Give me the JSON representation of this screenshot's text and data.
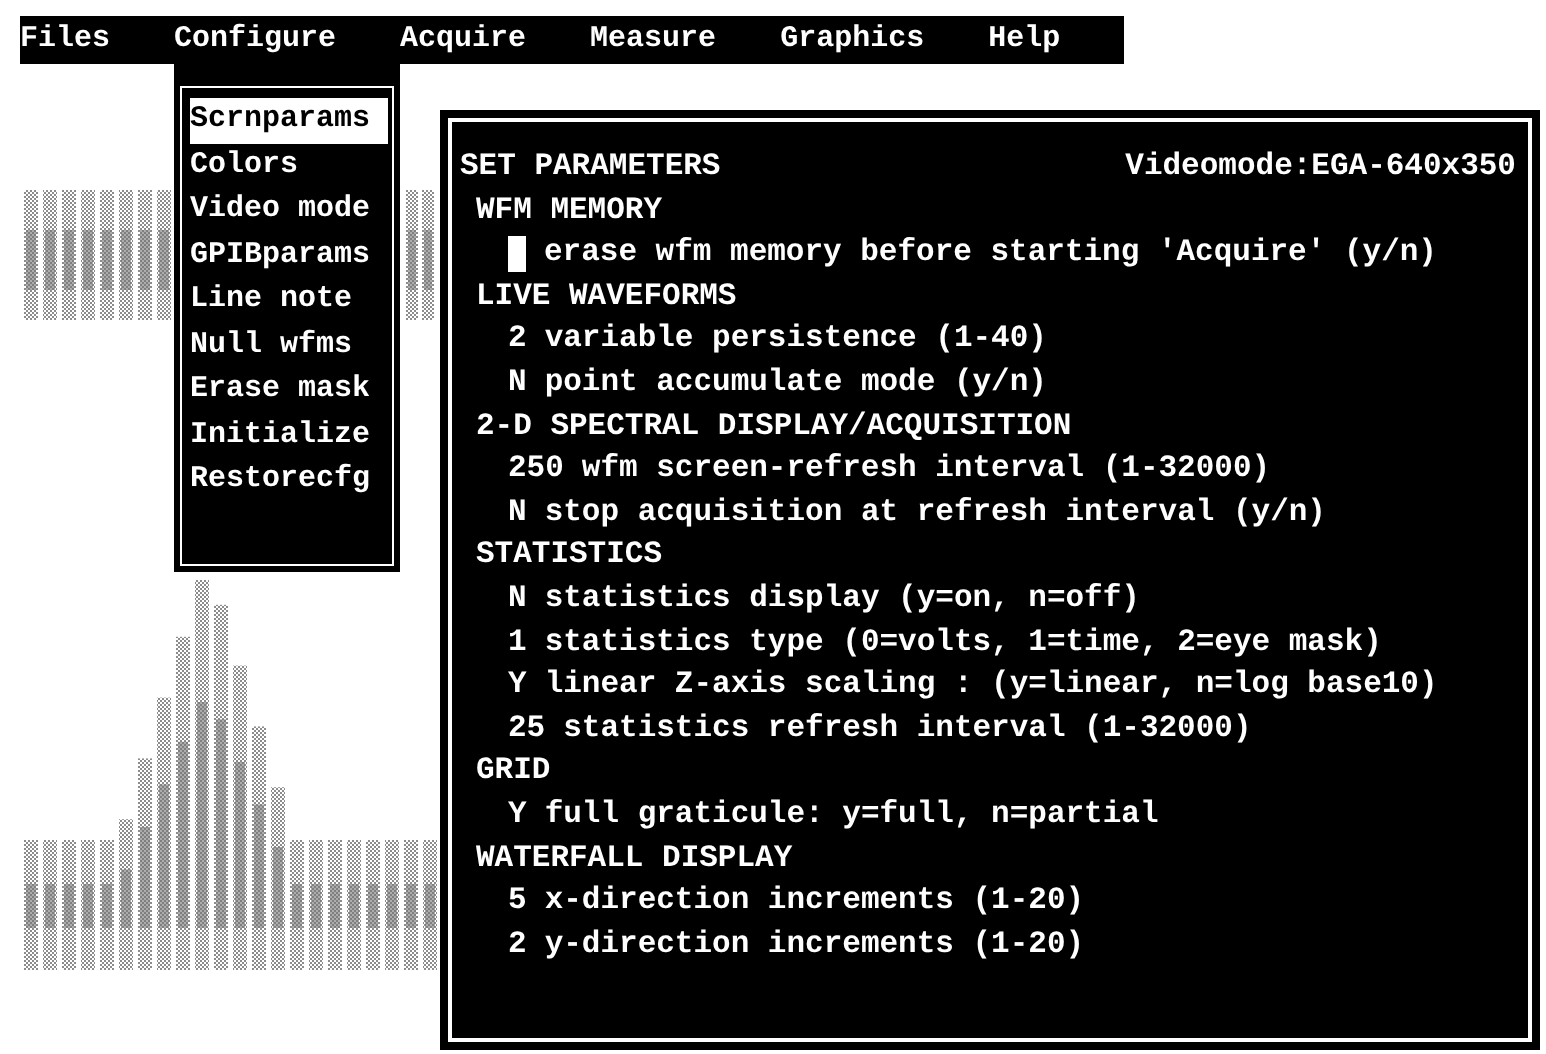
{
  "menu_bar": [
    {
      "label": "Files",
      "selected": false
    },
    {
      "label": "Configure",
      "selected": true
    },
    {
      "label": "Acquire",
      "selected": false
    },
    {
      "label": "Measure",
      "selected": false
    },
    {
      "label": "Graphics",
      "selected": false
    },
    {
      "label": "Help",
      "selected": false
    }
  ],
  "dropdown": [
    {
      "label": "Scrnparams",
      "selected": true
    },
    {
      "label": "Colors",
      "selected": false
    },
    {
      "label": "Video mode",
      "selected": false
    },
    {
      "label": "GPIBparams",
      "selected": false
    },
    {
      "label": "Line note",
      "selected": false
    },
    {
      "label": "Null wfms",
      "selected": false
    },
    {
      "label": "Erase mask",
      "selected": false
    },
    {
      "label": "Initialize",
      "selected": false
    },
    {
      "label": "Restorecfg",
      "selected": false
    }
  ],
  "dialog": {
    "title": "SET PARAMETERS",
    "video_mode": "Videomode:EGA-640x350",
    "sections": [
      {
        "title": "WFM MEMORY",
        "params": [
          {
            "focused": true,
            "description": "erase wfm memory before starting 'Acquire' (y/n)"
          }
        ]
      },
      {
        "title": "LIVE WAVEFORMS",
        "params": [
          {
            "focused": false,
            "setting": "2",
            "description": "variable persistence (1-40)"
          },
          {
            "focused": false,
            "setting": "N",
            "description": "point accumulate mode (y/n)"
          }
        ]
      },
      {
        "title": "2-D SPECTRAL DISPLAY/ACQUISITION",
        "params": [
          {
            "focused": false,
            "setting": "250",
            "description": "wfm screen-refresh interval (1-32000)"
          },
          {
            "focused": false,
            "setting": "N",
            "description": "stop acquisition at refresh interval (y/n)"
          }
        ]
      },
      {
        "title": "STATISTICS",
        "params": [
          {
            "focused": false,
            "setting": "N",
            "description": "statistics display (y=on, n=off)"
          },
          {
            "focused": false,
            "setting": "1",
            "description": "statistics type (0=volts, 1=time, 2=eye mask)"
          },
          {
            "focused": false,
            "setting": "Y",
            "description": "linear Z-axis scaling : (y=linear, n=log base10)"
          },
          {
            "focused": false,
            "setting": "25",
            "description": "statistics refresh interval (1-32000)"
          }
        ]
      },
      {
        "title": "GRID",
        "params": [
          {
            "focused": false,
            "setting": "Y",
            "description": "full graticule: y=full, n=partial"
          }
        ]
      },
      {
        "title": "WATERFALL DISPLAY",
        "params": [
          {
            "focused": false,
            "setting": "5",
            "description": "x-direction increments (1-20)"
          },
          {
            "focused": false,
            "setting": "2",
            "description": "y-direction increments (1-20)"
          }
        ]
      }
    ]
  }
}
